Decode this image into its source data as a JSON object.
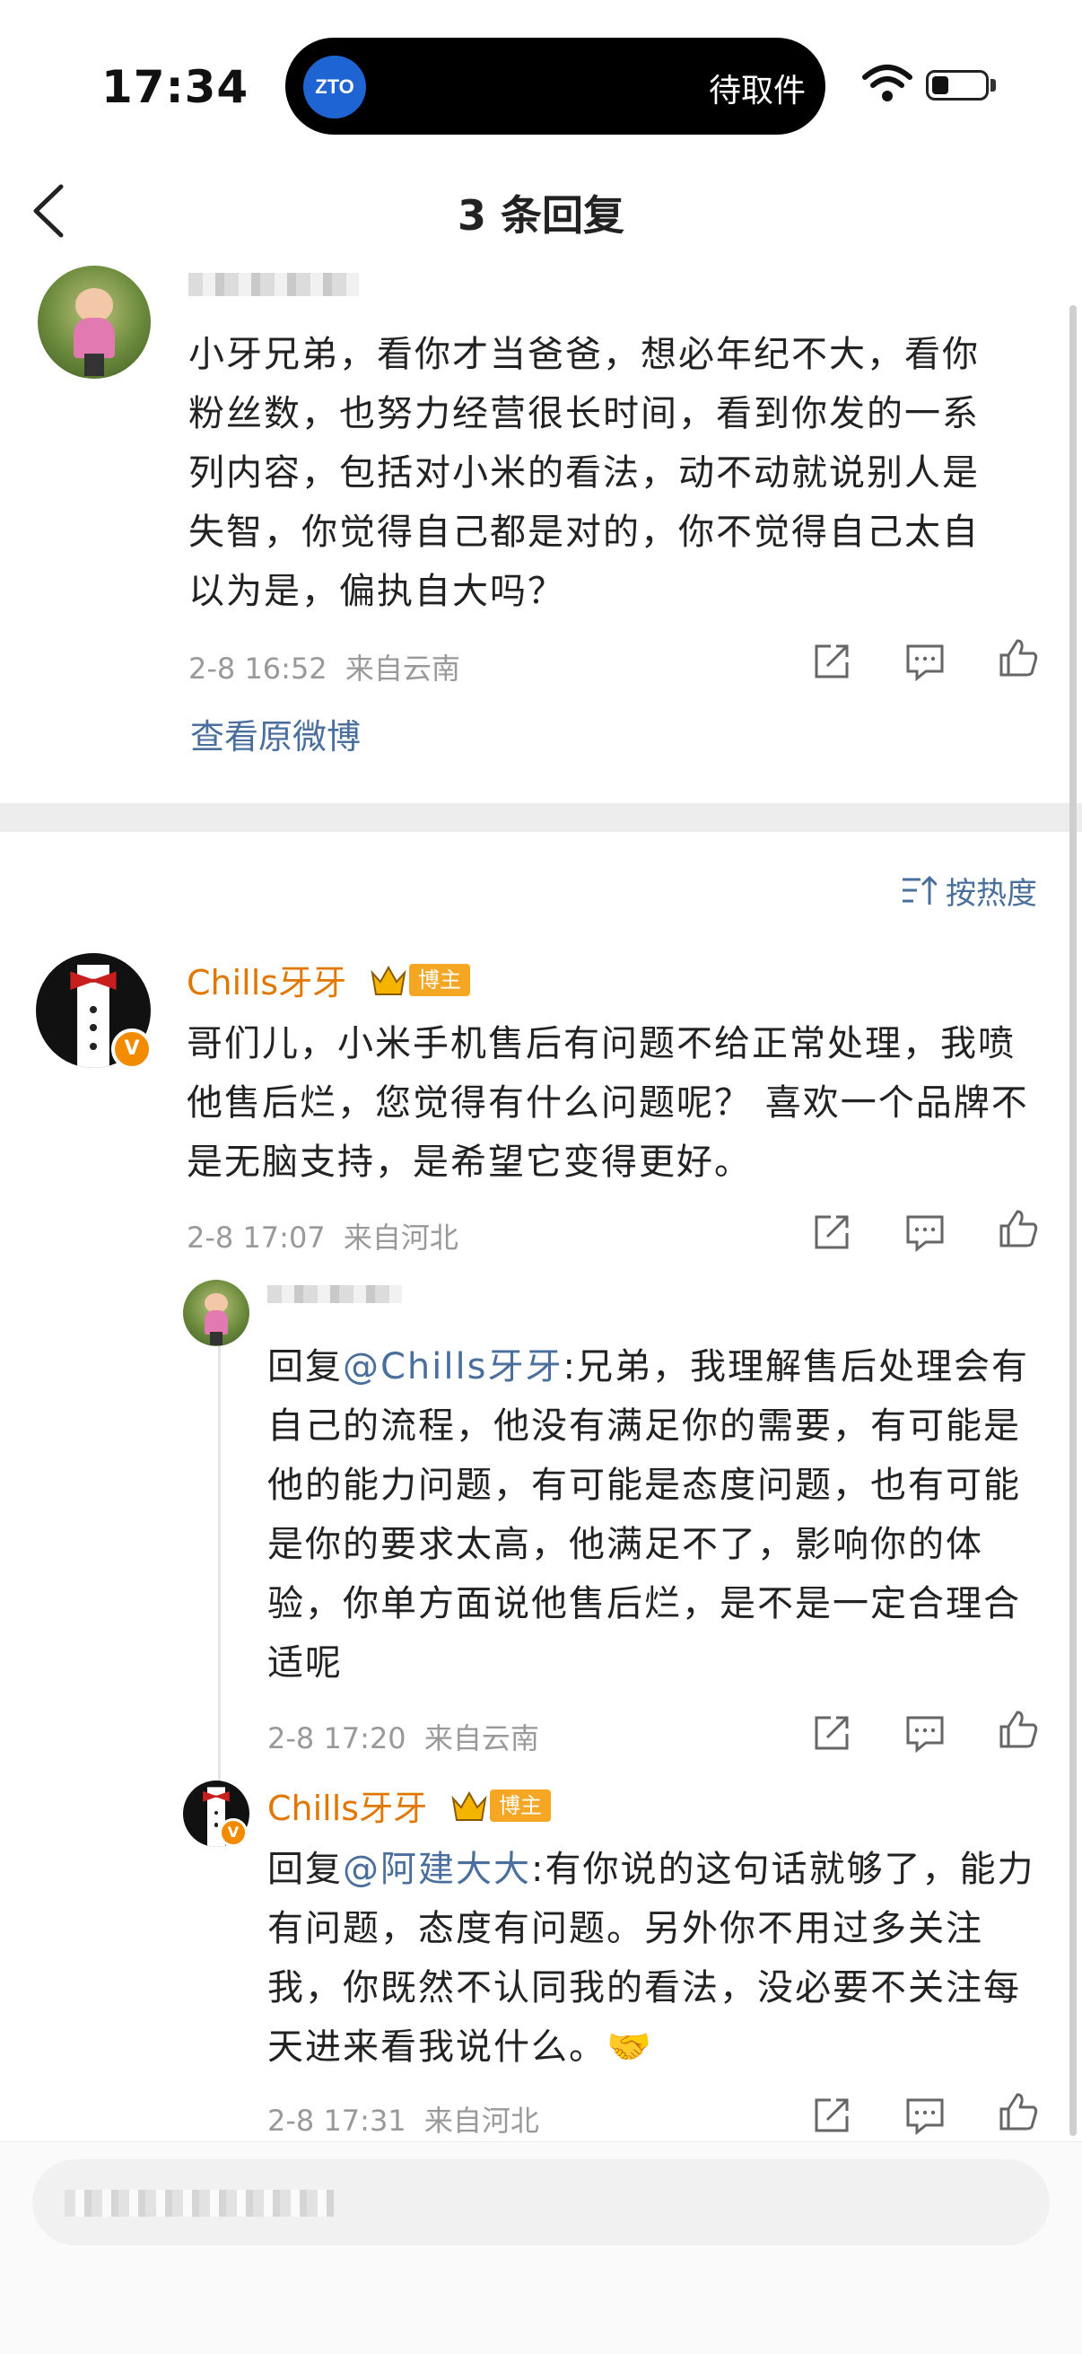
{
  "status_bar": {
    "time": "17:34",
    "carrier_logo_text": "ZTO",
    "live_activity": "待取件"
  },
  "header": {
    "title": "3 条回复"
  },
  "root_comment": {
    "text": "小牙兄弟，看你才当爸爸，想必年纪不大，看你粉丝数，也努力经营很长时间，看到你发的一系列内容，包括对小米的看法，动不动就说别人是失智，你觉得自己都是对的，你不觉得自己太自以为是，偏执自大吗？",
    "time": "2-8 16:52",
    "location": "来自云南",
    "view_original": "查看原微博"
  },
  "sort": {
    "label": "按热度"
  },
  "reply_main": {
    "author": "Chills牙牙",
    "badge": "博主",
    "verified": "V",
    "text": "哥们儿，小米手机售后有问题不给正常处理，我喷他售后烂，您觉得有什么问题呢？  喜欢一个品牌不是无脑支持，是希望它变得更好。",
    "time": "2-8 17:07",
    "location": "来自河北"
  },
  "nested_1": {
    "prefix": "回复",
    "mention": "@Chills牙牙",
    "text": ":兄弟，我理解售后处理会有自己的流程，他没有满足你的需要，有可能是他的能力问题，有可能是态度问题，也有可能是你的要求太高，他满足不了，影响你的体验，你单方面说他售后烂，是不是一定合理合适呢",
    "time": "2-8 17:20",
    "location": "来自云南"
  },
  "nested_2": {
    "author": "Chills牙牙",
    "badge": "博主",
    "verified": "V",
    "prefix": "回复",
    "mention": "@阿建大大",
    "text": ":有你说的这句话就够了，能力有问题，态度有问题。另外你不用过多关注我，你既然不认同我的看法，没必要不关注每天进来看我说什么。",
    "emoji": "🤝",
    "time": "2-8 17:31",
    "location": "来自河北"
  },
  "colors": {
    "link": "#4a6f9c",
    "author": "#e07800",
    "badge": "#f5a623"
  }
}
